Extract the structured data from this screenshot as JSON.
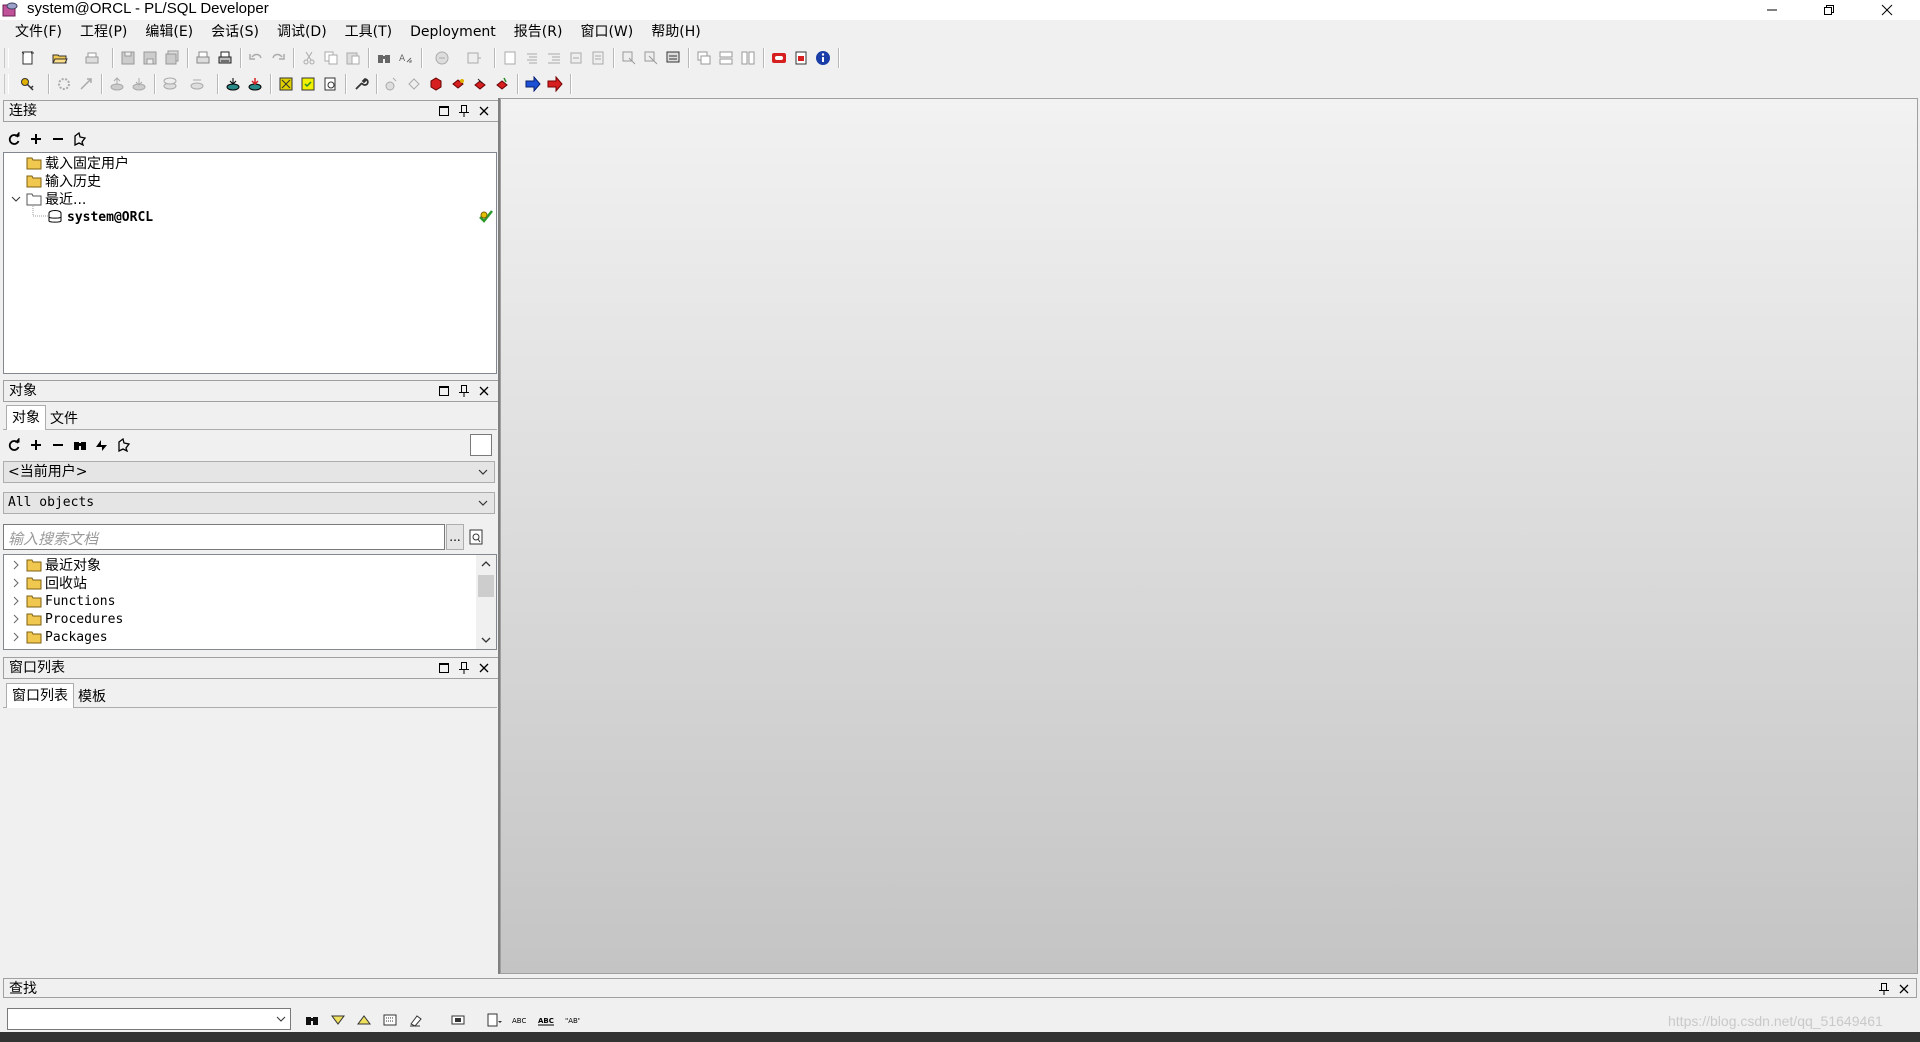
{
  "window": {
    "title": "system@ORCL - PL/SQL Developer"
  },
  "menu": [
    "文件(F)",
    "工程(P)",
    "编辑(E)",
    "会话(S)",
    "调试(D)",
    "工具(T)",
    "Deployment",
    "报告(R)",
    "窗口(W)",
    "帮助(H)"
  ],
  "connections_panel": {
    "title": "连接",
    "tree": [
      {
        "label": "载入固定用户"
      },
      {
        "label": "输入历史"
      },
      {
        "label": "最近..."
      },
      {
        "label": "system@ORCL"
      }
    ]
  },
  "objects_panel": {
    "title": "对象",
    "tabs": [
      "对象",
      "文件"
    ],
    "user_select": "<当前用户>",
    "filter_select": "All objects",
    "search_placeholder": "输入搜索文档",
    "ellipsis": "...",
    "tree": [
      {
        "label": "最近对象"
      },
      {
        "label": "回收站"
      },
      {
        "label": "Functions"
      },
      {
        "label": "Procedures"
      },
      {
        "label": "Packages"
      }
    ]
  },
  "window_list_panel": {
    "title": "窗口列表",
    "tabs": [
      "窗口列表",
      "模板"
    ]
  },
  "find_panel": {
    "title": "查找",
    "input_value": ""
  },
  "watermark": "https://blog.csdn.net/qq_51649461",
  "icons": {
    "accent_blue": "#1a4fd6",
    "accent_red": "#d62020",
    "folder": "#f0c850"
  }
}
